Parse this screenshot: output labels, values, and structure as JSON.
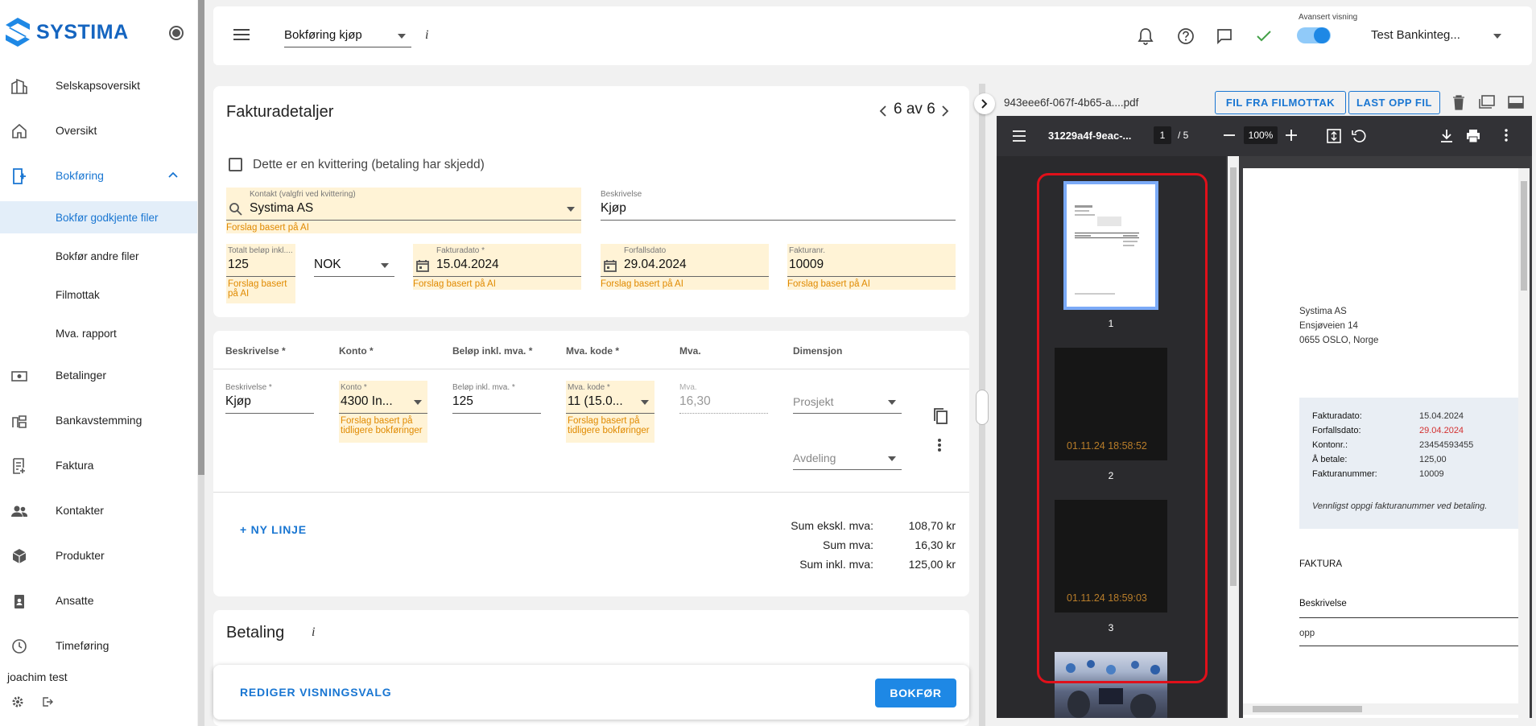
{
  "sidebar": {
    "logo": "SYSTIMA",
    "items": [
      {
        "label": "Selskapsoversikt",
        "icon": "buildings-icon"
      },
      {
        "label": "Oversikt",
        "icon": "home-icon"
      },
      {
        "label": "Bokføring",
        "icon": "bookkeeping-icon"
      },
      {
        "label": "Betalinger",
        "icon": "payments-icon"
      },
      {
        "label": "Bankavstemming",
        "icon": "bank-reconciliation-icon"
      },
      {
        "label": "Faktura",
        "icon": "invoice-icon"
      },
      {
        "label": "Kontakter",
        "icon": "contacts-icon"
      },
      {
        "label": "Produkter",
        "icon": "products-icon"
      },
      {
        "label": "Ansatte",
        "icon": "employees-icon"
      },
      {
        "label": "Timeføring",
        "icon": "clock-icon"
      }
    ],
    "subitems": [
      "Bokfør godkjente filer",
      "Bokfør andre filer",
      "Filmottak",
      "Mva. rapport"
    ],
    "user": "joachim test"
  },
  "topbar": {
    "view_select": "Bokføring kjøp",
    "info": "i",
    "toggle_label": "Avansert visning",
    "company": "Test Bankinteg..."
  },
  "invoice": {
    "title": "Fakturadetaljer",
    "pager": "6 av 6",
    "receipt_label": "Dette er en kvittering (betaling har skjedd)",
    "contact_label": "Kontakt (valgfri ved kvittering)",
    "contact_value": "Systima AS",
    "ai_hint": "Forslag basert på AI",
    "desc_label": "Beskrivelse",
    "desc_value": "Kjøp",
    "total_label": "Totalt beløp inkl....",
    "total_value": "125",
    "total_hint_1": "Forslag basert",
    "total_hint_2": "på AI",
    "currency": "NOK",
    "invoice_date_label": "Fakturadato *",
    "invoice_date": "15.04.2024",
    "due_date_label": "Forfallsdato",
    "due_date": "29.04.2024",
    "invoice_no_label": "Fakturanr.",
    "invoice_no": "10009"
  },
  "lines": {
    "headers": [
      "Beskrivelse *",
      "Konto *",
      "Beløp inkl. mva. *",
      "Mva. kode *",
      "Mva.",
      "Dimensjon"
    ],
    "desc_label": "Beskrivelse *",
    "desc_value": "Kjøp",
    "account_label": "Konto *",
    "account_value": "4300 In...",
    "account_hint_1": "Forslag basert på",
    "account_hint_2": "tidligere bokføringer",
    "amount_label": "Beløp inkl. mva. *",
    "amount_value": "125",
    "vat_label": "Mva. kode *",
    "vat_value": "11 (15.0...",
    "vat_hint_1": "Forslag basert på",
    "vat_hint_2": "tidligere bokføringer",
    "mva_label": "Mva.",
    "mva_value": "16,30",
    "project_placeholder": "Prosjekt",
    "department_placeholder": "Avdeling",
    "new_line": "+ NY LINJE",
    "sum_ex_label": "Sum ekskl. mva:",
    "sum_ex": "108,70 kr",
    "sum_vat_label": "Sum mva:",
    "sum_vat": "16,30 kr",
    "sum_inc_label": "Sum inkl. mva:",
    "sum_inc": "125,00 kr"
  },
  "payment": {
    "title": "Betaling",
    "info": "i"
  },
  "footer": {
    "edit_view": "REDIGER VISNINGSVALG",
    "book": "BOKFØR"
  },
  "file": {
    "name": "943eee6f-067f-4b65-a....pdf",
    "from_inbox": "FIL FRA FILMOTTAK",
    "upload": "LAST OPP FIL"
  },
  "pdf": {
    "title": "31229a4f-9eac-...",
    "page": "1",
    "pages": "/ 5",
    "zoom": "100%",
    "thumbs": [
      {
        "num": "1",
        "stamp": ""
      },
      {
        "num": "2",
        "stamp": "01.11.24 18:58:52"
      },
      {
        "num": "3",
        "stamp": "01.11.24 18:59:03"
      }
    ],
    "doc": {
      "sender_1": "Systima AS",
      "sender_2": "Ensjøveien 14",
      "sender_3": "0655 OSLO, Norge",
      "rows": [
        {
          "k": "Fakturadato:",
          "v": "15.04.2024"
        },
        {
          "k": "Forfallsdato:",
          "v": "29.04.2024"
        },
        {
          "k": "Kontonr.:",
          "v": "23454593455"
        },
        {
          "k": "Å betale:",
          "v": "125,00"
        },
        {
          "k": "Fakturanummer:",
          "v": "10009"
        }
      ],
      "note": "Vennligst oppgi fakturanummer ved betaling.",
      "heading": "FAKTURA",
      "col": "Beskrivelse",
      "item": "opp"
    }
  },
  "colors": {
    "accent": "#1976d2",
    "ai_bg": "#fff3d6",
    "ai_text": "#e08a00",
    "highlight_border": "#e0101a",
    "due_red": "#d32f2f"
  }
}
